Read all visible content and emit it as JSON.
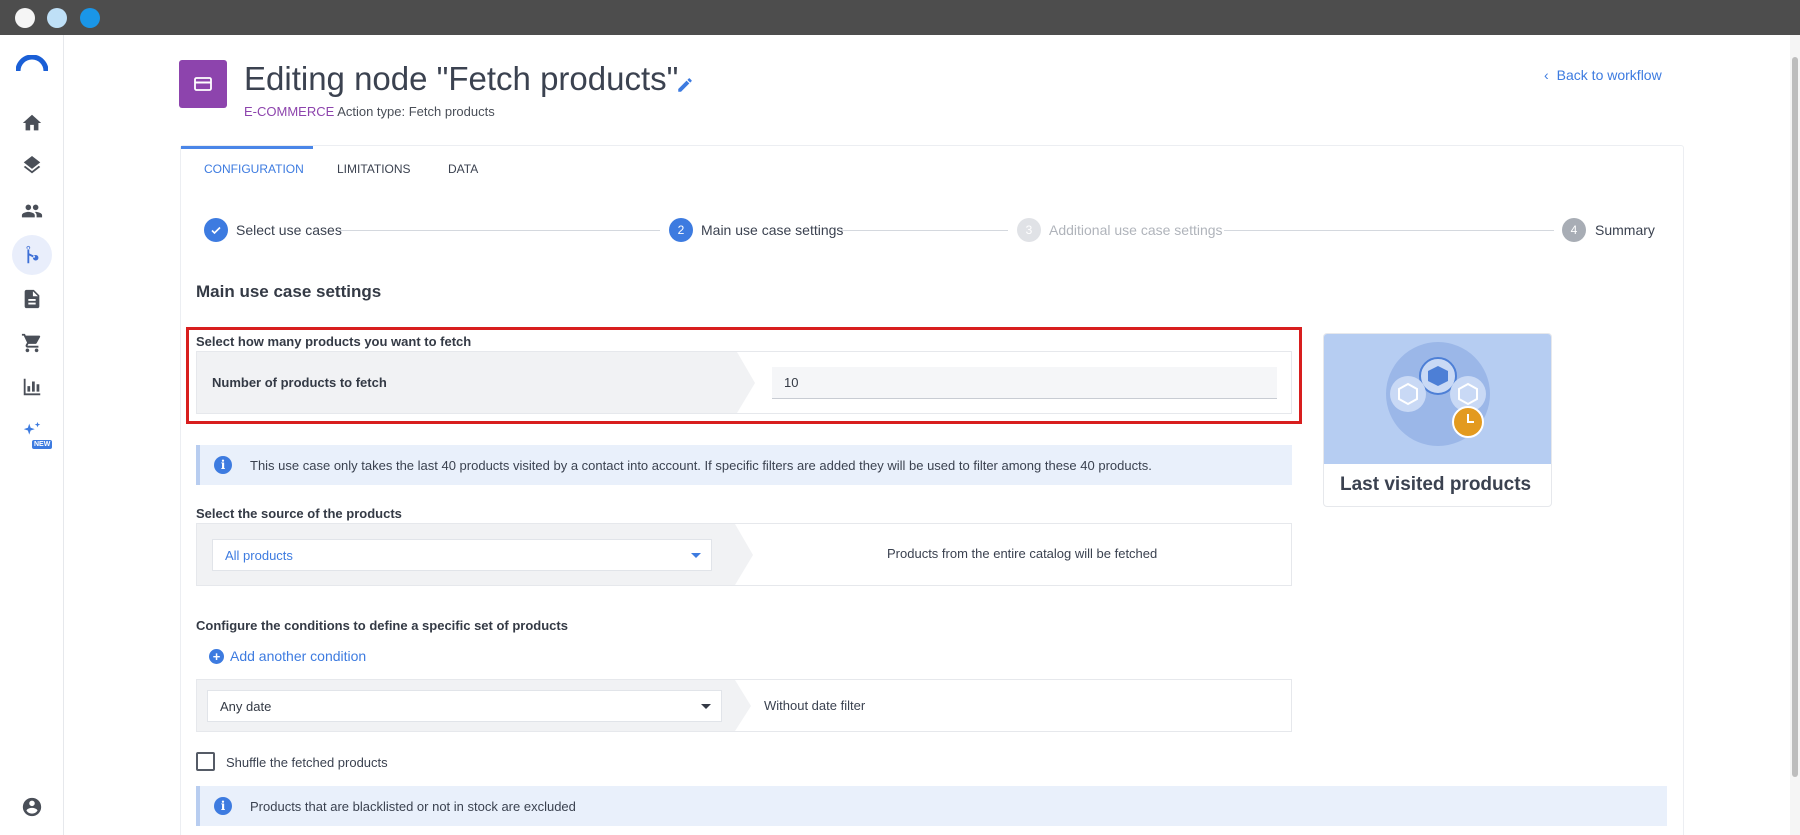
{
  "header": {
    "title": "Editing node \"Fetch products\"",
    "category": "E-COMMERCE",
    "action_type": "Action type: Fetch products",
    "back_link": "Back to workflow"
  },
  "tabs": [
    {
      "label": "CONFIGURATION",
      "active": true
    },
    {
      "label": "LIMITATIONS",
      "active": false
    },
    {
      "label": "DATA",
      "active": false
    }
  ],
  "stepper": [
    {
      "number": "",
      "label": "Select use cases",
      "state": "done"
    },
    {
      "number": "2",
      "label": "Main use case settings",
      "state": "active"
    },
    {
      "number": "3",
      "label": "Additional use case settings",
      "state": "upcoming"
    },
    {
      "number": "4",
      "label": "Summary",
      "state": "upcoming"
    }
  ],
  "main": {
    "section_title": "Main use case settings",
    "fetch_label": "Select how many products you want to fetch",
    "fetch_field_label": "Number of products to fetch",
    "fetch_value": "10",
    "info_text": "This use case only takes the last 40 products visited by a contact into account. If specific filters are added they will be used to filter among these 40 products.",
    "source_label": "Select the source of the products",
    "source_value": "All products",
    "source_desc": "Products from the entire catalog will be fetched",
    "conditions_label": "Configure the conditions to define a specific set of products",
    "add_condition": "Add another condition",
    "date_value": "Any date",
    "date_desc": "Without date filter",
    "shuffle_label": "Shuffle the fetched products",
    "exclusion_info": "Products that are blacklisted or not in stock are excluded"
  },
  "usecase": {
    "title": "Last visited products"
  },
  "sidebar": {
    "items": [
      "home-icon",
      "layers-icon",
      "contacts-icon",
      "workflow-icon",
      "document-icon",
      "cart-icon",
      "chart-icon",
      "ai-sparkle-icon",
      "account-icon"
    ],
    "new_badge": "NEW"
  },
  "colors": {
    "accent": "#3d7be0",
    "category": "#8d44ad",
    "highlight": "#d81e1e"
  }
}
